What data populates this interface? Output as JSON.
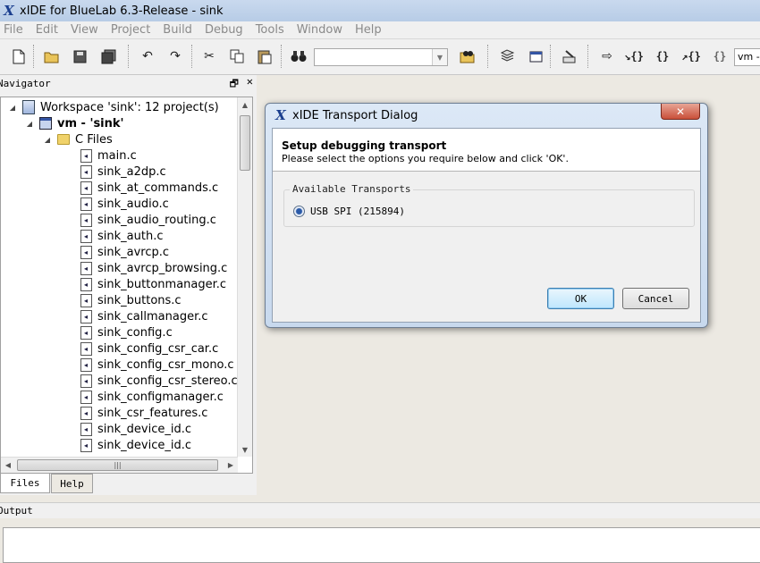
{
  "window": {
    "title": "xIDE for BlueLab 6.3-Release - sink",
    "app_icon_glyph": "X"
  },
  "menu": [
    "File",
    "Edit",
    "View",
    "Project",
    "Build",
    "Debug",
    "Tools",
    "Window",
    "Help"
  ],
  "toolbar": {
    "find_value": "",
    "config_value": "vm -"
  },
  "navigator": {
    "title": "Navigator",
    "workspace_label": "Workspace 'sink': 12 project(s)",
    "project_label": "vm - 'sink'",
    "folder_label": "C Files",
    "files": [
      "main.c",
      "sink_a2dp.c",
      "sink_at_commands.c",
      "sink_audio.c",
      "sink_audio_routing.c",
      "sink_auth.c",
      "sink_avrcp.c",
      "sink_avrcp_browsing.c",
      "sink_buttonmanager.c",
      "sink_buttons.c",
      "sink_callmanager.c",
      "sink_config.c",
      "sink_config_csr_car.c",
      "sink_config_csr_mono.c",
      "sink_config_csr_stereo.c",
      "sink_configmanager.c",
      "sink_csr_features.c",
      "sink_device_id.c",
      "sink_device_id.c"
    ],
    "tabs": {
      "files": "Files",
      "help": "Help"
    }
  },
  "output": {
    "title": "Output"
  },
  "dialog": {
    "title": "xIDE Transport Dialog",
    "heading": "Setup debugging transport",
    "subtext": "Please select the options you require below and click 'OK'.",
    "group_label": "Available Transports",
    "transport_option": "USB SPI (215894)",
    "ok_label": "OK",
    "cancel_label": "Cancel"
  },
  "colors": {
    "titlebar": "#c9d9ee",
    "dialog_frame": "#dce8f6",
    "close_button": "#c9503a",
    "menu_disabled": "#8a8a8a"
  }
}
